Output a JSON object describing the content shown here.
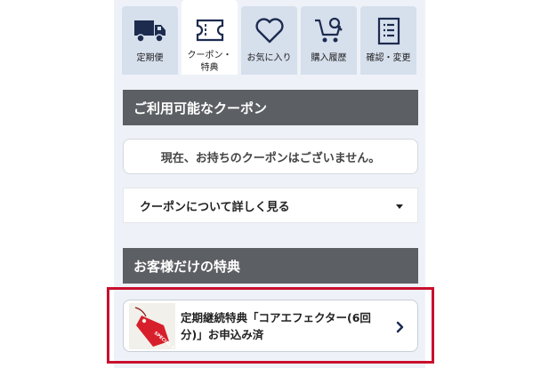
{
  "tabs": [
    {
      "label": "定期便",
      "icon": "truck-icon",
      "active": false
    },
    {
      "label": "クーポン・\n特典",
      "icon": "ticket-icon",
      "active": true
    },
    {
      "label": "お気に入り",
      "icon": "heart-icon",
      "active": false
    },
    {
      "label": "購入履歴",
      "icon": "cart-search-icon",
      "active": false
    },
    {
      "label": "確認・変更",
      "icon": "document-list-icon",
      "active": false
    }
  ],
  "coupons": {
    "header": "ご利用可能なクーポン",
    "empty_message": "現在、お持ちのクーポンはございません。",
    "details_label": "クーポンについて詳しく見る"
  },
  "benefits": {
    "header": "お客様だけの特典",
    "item_text": "定期継続特典「コアエフェクター(6回分)」お申込み済",
    "item_image": "red-tag-image",
    "tag_text": "SPECIAL PRICE"
  },
  "colors": {
    "header_bg": "#5c5f63",
    "panel_bg": "#eef2f8",
    "tab_bg": "#d6dfec",
    "highlight_border": "#c8102e",
    "tag_red": "#d71f2b"
  }
}
